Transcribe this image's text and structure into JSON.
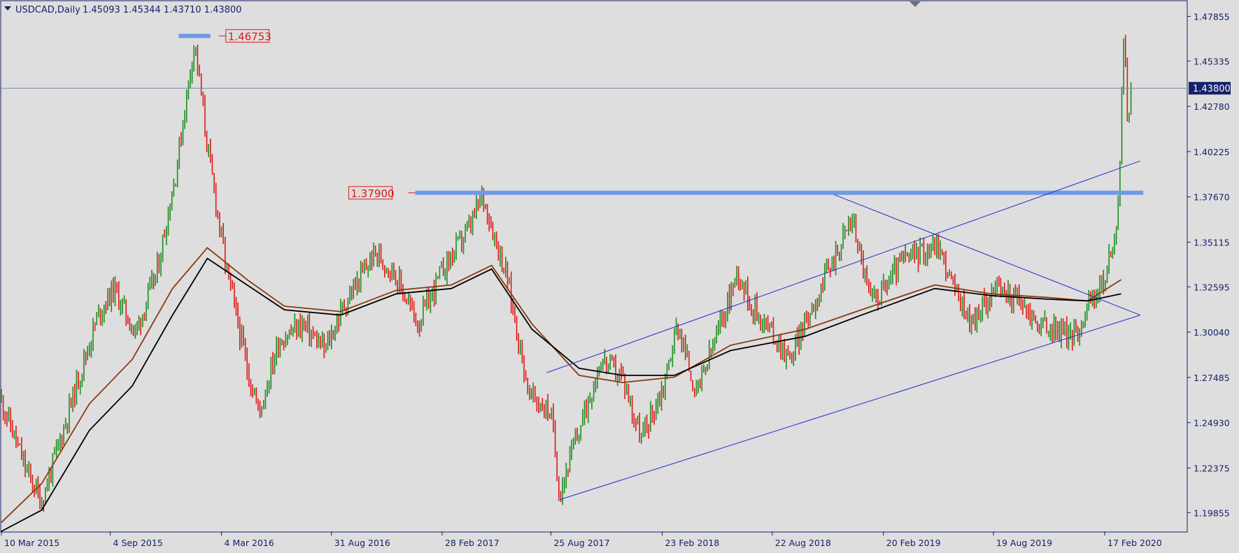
{
  "header": {
    "symbol_label": "USDCAD,Daily",
    "ohlc_label": "1.45093 1.45344 1.43710 1.43800"
  },
  "colors": {
    "background": "#dedede",
    "axis": "#15216b",
    "bull_candle": "#1e8c1e",
    "bear_candle": "#e01818",
    "level_line": "#6f9ae6",
    "trend_line": "#1f2fc9",
    "ma_fast": "#8b3a10",
    "ma_slow": "#000000",
    "label_red": "#e01818"
  },
  "chart_data": {
    "type": "candlestick",
    "symbol": "USDCAD",
    "timeframe": "Daily",
    "last_bar": {
      "open": 1.45093,
      "high": 1.45344,
      "low": 1.4371,
      "close": 1.438
    },
    "current_price_label": "1.43800",
    "ylim": [
      1.188,
      1.487
    ],
    "y_ticks": [
      "1.47855",
      "1.45335",
      "1.42780",
      "1.40225",
      "1.37670",
      "1.35115",
      "1.32595",
      "1.30040",
      "1.27485",
      "1.24930",
      "1.22375",
      "1.19855"
    ],
    "x_ticks": [
      "10 Mar 2015",
      "4 Sep 2015",
      "4 Mar 2016",
      "31 Aug 2016",
      "28 Feb 2017",
      "25 Aug 2017",
      "23 Feb 2018",
      "22 Aug 2018",
      "20 Feb 2019",
      "19 Aug 2019",
      "17 Feb 2020"
    ],
    "x_tick_dates": [
      "2015-03-10",
      "2015-09-04",
      "2016-03-04",
      "2016-08-31",
      "2017-02-28",
      "2017-08-25",
      "2018-02-23",
      "2018-08-22",
      "2019-02-20",
      "2019-08-19",
      "2020-02-17"
    ],
    "x_range": [
      "2015-03-10",
      "2020-07-01"
    ],
    "price_path": [
      [
        "2015-03-10",
        1.262
      ],
      [
        "2015-04-20",
        1.222
      ],
      [
        "2015-05-15",
        1.205
      ],
      [
        "2015-06-10",
        1.235
      ],
      [
        "2015-07-15",
        1.275
      ],
      [
        "2015-08-15",
        1.31
      ],
      [
        "2015-09-10",
        1.325
      ],
      [
        "2015-10-15",
        1.3
      ],
      [
        "2015-11-20",
        1.335
      ],
      [
        "2015-12-20",
        1.39
      ],
      [
        "2016-01-20",
        1.465
      ],
      [
        "2016-02-10",
        1.405
      ],
      [
        "2016-03-10",
        1.34
      ],
      [
        "2016-04-15",
        1.28
      ],
      [
        "2016-05-05",
        1.255
      ],
      [
        "2016-06-05",
        1.295
      ],
      [
        "2016-07-15",
        1.305
      ],
      [
        "2016-08-20",
        1.29
      ],
      [
        "2016-09-20",
        1.315
      ],
      [
        "2016-11-10",
        1.345
      ],
      [
        "2016-12-10",
        1.335
      ],
      [
        "2017-01-20",
        1.305
      ],
      [
        "2017-02-28",
        1.335
      ],
      [
        "2017-04-15",
        1.36
      ],
      [
        "2017-05-05",
        1.378
      ],
      [
        "2017-06-15",
        1.33
      ],
      [
        "2017-07-20",
        1.265
      ],
      [
        "2017-08-25",
        1.255
      ],
      [
        "2017-09-08",
        1.21
      ],
      [
        "2017-10-10",
        1.245
      ],
      [
        "2017-11-15",
        1.285
      ],
      [
        "2017-12-20",
        1.275
      ],
      [
        "2018-01-20",
        1.24
      ],
      [
        "2018-02-25",
        1.27
      ],
      [
        "2018-03-20",
        1.305
      ],
      [
        "2018-04-20",
        1.265
      ],
      [
        "2018-05-20",
        1.295
      ],
      [
        "2018-06-27",
        1.335
      ],
      [
        "2018-07-20",
        1.315
      ],
      [
        "2018-08-22",
        1.3
      ],
      [
        "2018-09-20",
        1.285
      ],
      [
        "2018-10-20",
        1.31
      ],
      [
        "2018-12-31",
        1.365
      ],
      [
        "2019-01-30",
        1.318
      ],
      [
        "2019-02-20",
        1.325
      ],
      [
        "2019-03-20",
        1.34
      ],
      [
        "2019-05-20",
        1.35
      ],
      [
        "2019-06-15",
        1.325
      ],
      [
        "2019-07-15",
        1.305
      ],
      [
        "2019-08-19",
        1.325
      ],
      [
        "2019-09-25",
        1.32
      ],
      [
        "2019-10-30",
        1.305
      ],
      [
        "2019-12-31",
        1.298
      ],
      [
        "2020-01-20",
        1.315
      ],
      [
        "2020-02-17",
        1.33
      ],
      [
        "2020-03-05",
        1.355
      ],
      [
        "2020-03-12",
        1.385
      ],
      [
        "2020-03-19",
        1.467
      ],
      [
        "2020-03-26",
        1.42
      ],
      [
        "2020-04-01",
        1.438
      ]
    ],
    "moving_averages": [
      {
        "color": "#8b3a10",
        "path": [
          [
            "2015-03-10",
            1.193
          ],
          [
            "2015-05-15",
            1.215
          ],
          [
            "2015-08-01",
            1.26
          ],
          [
            "2015-10-10",
            1.285
          ],
          [
            "2015-12-15",
            1.325
          ],
          [
            "2016-02-10",
            1.348
          ],
          [
            "2016-04-15",
            1.33
          ],
          [
            "2016-06-15",
            1.315
          ],
          [
            "2016-09-15",
            1.312
          ],
          [
            "2016-12-15",
            1.324
          ],
          [
            "2017-03-15",
            1.327
          ],
          [
            "2017-05-20",
            1.338
          ],
          [
            "2017-07-25",
            1.305
          ],
          [
            "2017-10-10",
            1.276
          ],
          [
            "2017-12-20",
            1.272
          ],
          [
            "2018-03-15",
            1.275
          ],
          [
            "2018-06-15",
            1.293
          ],
          [
            "2018-10-15",
            1.302
          ],
          [
            "2019-01-15",
            1.313
          ],
          [
            "2019-05-15",
            1.327
          ],
          [
            "2019-08-15",
            1.322
          ],
          [
            "2019-11-15",
            1.32
          ],
          [
            "2020-01-20",
            1.318
          ],
          [
            "2020-03-15",
            1.33
          ]
        ]
      },
      {
        "color": "#000000",
        "path": [
          [
            "2015-03-10",
            1.188
          ],
          [
            "2015-05-15",
            1.2
          ],
          [
            "2015-08-01",
            1.245
          ],
          [
            "2015-10-10",
            1.27
          ],
          [
            "2015-12-15",
            1.31
          ],
          [
            "2016-02-10",
            1.342
          ],
          [
            "2016-04-15",
            1.327
          ],
          [
            "2016-06-15",
            1.313
          ],
          [
            "2016-09-15",
            1.31
          ],
          [
            "2016-12-15",
            1.322
          ],
          [
            "2017-03-15",
            1.325
          ],
          [
            "2017-05-20",
            1.336
          ],
          [
            "2017-07-25",
            1.302
          ],
          [
            "2017-10-10",
            1.28
          ],
          [
            "2017-12-20",
            1.276
          ],
          [
            "2018-03-15",
            1.276
          ],
          [
            "2018-06-15",
            1.29
          ],
          [
            "2018-10-15",
            1.298
          ],
          [
            "2019-01-15",
            1.31
          ],
          [
            "2019-05-15",
            1.325
          ],
          [
            "2019-08-15",
            1.321
          ],
          [
            "2019-11-15",
            1.319
          ],
          [
            "2020-01-20",
            1.318
          ],
          [
            "2020-03-15",
            1.322
          ]
        ]
      }
    ],
    "horizontal_levels": [
      {
        "value": 1.46753,
        "label": "1.46753",
        "from": "2015-12-25",
        "to": "2016-02-15"
      },
      {
        "value": 1.379,
        "label": "1.37900",
        "from": "2017-01-15",
        "to": "2020-04-20"
      }
    ],
    "trend_lines": [
      {
        "name": "channel-lower",
        "from": [
          "2017-09-05",
          1.2055
        ],
        "to": [
          "2020-04-15",
          1.31
        ]
      },
      {
        "name": "channel-upper",
        "from": [
          "2017-08-18",
          1.2775
        ],
        "to": [
          "2020-04-15",
          1.397
        ]
      },
      {
        "name": "triangle-upper",
        "from": [
          "2018-12-01",
          1.378
        ],
        "to": [
          "2020-04-15",
          1.31
        ]
      }
    ]
  }
}
